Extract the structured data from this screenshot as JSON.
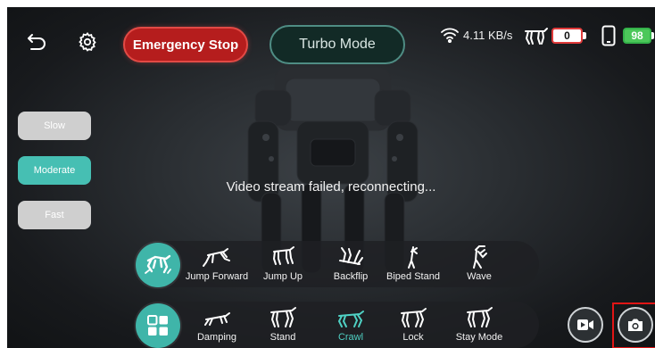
{
  "topbar": {
    "back_icon": "back-arrow-icon",
    "settings_icon": "gear-icon",
    "emergency_label": "Emergency Stop",
    "turbo_label": "Turbo Mode",
    "net_speed": "4.11 KB/s",
    "dog_battery": "0",
    "phone_battery": "98"
  },
  "speed": {
    "items": [
      {
        "label": "Slow",
        "active": false
      },
      {
        "label": "Moderate",
        "active": true
      },
      {
        "label": "Fast",
        "active": false
      }
    ]
  },
  "stream": {
    "message": "Video stream failed, reconnecting..."
  },
  "tricks": {
    "items": [
      {
        "label": "Jump Forward"
      },
      {
        "label": "Jump Up"
      },
      {
        "label": "Backflip"
      },
      {
        "label": "Biped Stand"
      },
      {
        "label": "Wave"
      }
    ]
  },
  "modes": {
    "items": [
      {
        "label": "Damping"
      },
      {
        "label": "Stand"
      },
      {
        "label": "Crawl",
        "active": true
      },
      {
        "label": "Lock"
      },
      {
        "label": "Stay Mode"
      }
    ]
  },
  "colors": {
    "accent": "#46bfb3",
    "emergency": "#b51d1d",
    "dog_battery_border": "#e03a3a",
    "phone_battery": "#4cc85a",
    "highlight": "#e01515"
  }
}
